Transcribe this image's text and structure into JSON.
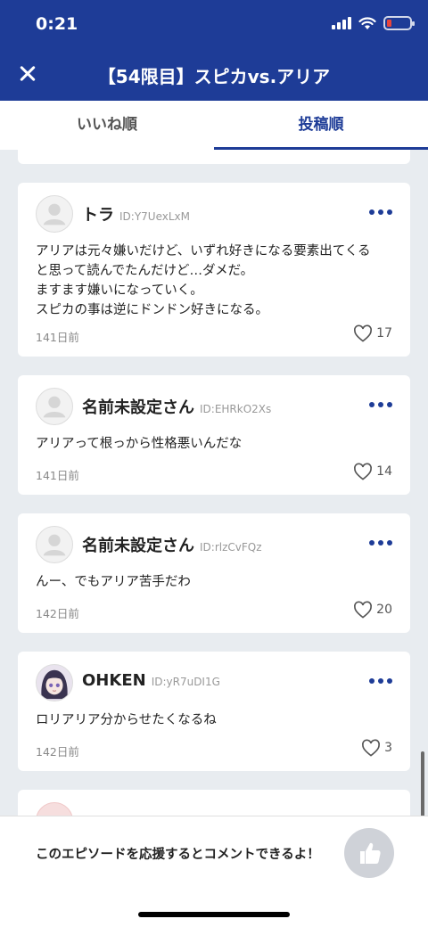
{
  "status_bar": {
    "time": "0:21"
  },
  "header": {
    "title": "【54限目】スピカvs.アリア"
  },
  "tabs": [
    {
      "label": "いいね順",
      "active": false
    },
    {
      "label": "投稿順",
      "active": true
    }
  ],
  "comments": [
    {
      "username": "トラ",
      "user_id": "ID:Y7UexLxM",
      "lines": [
        "アリアは元々嫌いだけど、いずれ好きになる要素出てくる",
        "と思って読んでたんだけど…ダメだ。",
        "ますます嫌いになっていく。",
        "スピカの事は逆にドンドン好きになる。"
      ],
      "date": "141日前",
      "likes": "17",
      "avatar": "default-avatar-icon"
    },
    {
      "username": "名前未設定さん",
      "user_id": "ID:EHRkO2Xs",
      "lines": [
        "アリアって根っから性格悪いんだな"
      ],
      "date": "141日前",
      "likes": "14",
      "avatar": "default-avatar-icon"
    },
    {
      "username": "名前未設定さん",
      "user_id": "ID:rlzCvFQz",
      "lines": [
        "んー、でもアリア苦手だわ"
      ],
      "date": "142日前",
      "likes": "20",
      "avatar": "default-avatar-icon"
    },
    {
      "username": "OHKEN",
      "user_id": "ID:yR7uDI1G",
      "lines": [
        "ロリアリア分からせたくなるね"
      ],
      "date": "142日前",
      "likes": "3",
      "avatar": "anime-character-avatar"
    }
  ],
  "bottom": {
    "cheer_text": "このエピソードを応援するとコメントできるよ！"
  },
  "colors": {
    "primary": "#1e3c97",
    "background": "#e8ecf0"
  }
}
